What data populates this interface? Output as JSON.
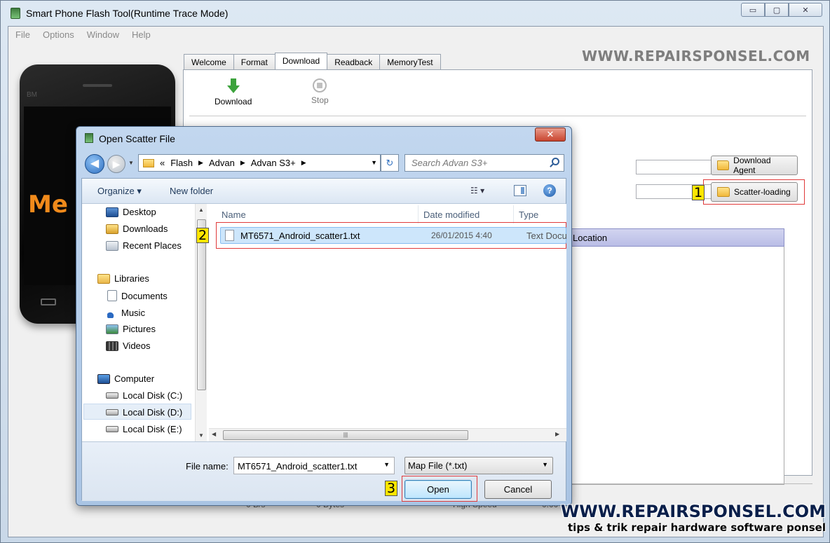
{
  "app": {
    "title": "Smart Phone Flash Tool(Runtime Trace Mode)",
    "window_controls": {
      "minimize": "▭",
      "maximize": "▢",
      "close": "✕"
    }
  },
  "menu": [
    "File",
    "Options",
    "Window",
    "Help"
  ],
  "phone": {
    "brand": "BM",
    "logo_text": "Me"
  },
  "watermarks": {
    "top": "WWW.REPAIRSPONSEL.COM",
    "bottom_main": "WWW.REPAIRSPONSEL.COM",
    "bottom_sub": "tips & trik repair hardware software ponsel"
  },
  "tabs": [
    "Welcome",
    "Format",
    "Download",
    "Readback",
    "MemoryTest"
  ],
  "active_tab": "Download",
  "toolbar": {
    "download_label": "Download",
    "stop_label": "Stop"
  },
  "side_buttons": {
    "download_agent": "Download Agent",
    "scatter_loading": "Scatter-loading"
  },
  "location_header": "Location",
  "status_bar": [
    "0 B/s",
    "0 Bytes",
    "High Speed",
    "0:00"
  ],
  "steps": {
    "one": "1",
    "two": "2",
    "three": "3"
  },
  "dialog": {
    "title": "Open Scatter File",
    "close": "✕",
    "breadcrumb": [
      "Flash",
      "Advan",
      "Advan S3+"
    ],
    "breadcrumb_prefix": "«",
    "search_placeholder": "Search Advan S3+",
    "commands": {
      "organize": "Organize ▾",
      "new_folder": "New folder",
      "views": "☷ ▾",
      "help": "?"
    },
    "nav_items": [
      {
        "label": "Desktop",
        "icon": "desktop-icon"
      },
      {
        "label": "Downloads",
        "icon": "downloads-icon"
      },
      {
        "label": "Recent Places",
        "icon": "recent-places-icon"
      },
      {
        "label": "Libraries",
        "icon": "libraries-icon"
      },
      {
        "label": "Documents",
        "icon": "documents-icon"
      },
      {
        "label": "Music",
        "icon": "music-icon"
      },
      {
        "label": "Pictures",
        "icon": "pictures-icon"
      },
      {
        "label": "Videos",
        "icon": "videos-icon"
      },
      {
        "label": "Computer",
        "icon": "computer-icon"
      },
      {
        "label": "Local Disk (C:)",
        "icon": "disk-icon"
      },
      {
        "label": "Local Disk (D:)",
        "icon": "disk-icon"
      },
      {
        "label": "Local Disk (E:)",
        "icon": "disk-icon"
      }
    ],
    "selected_nav": "Local Disk (D:)",
    "columns": [
      "Name",
      "Date modified",
      "Type"
    ],
    "files": [
      {
        "name": "MT6571_Android_scatter1.txt",
        "date": "26/01/2015 4:40",
        "type": "Text Document"
      }
    ],
    "file_name_label": "File name:",
    "file_name_value": "MT6571_Android_scatter1.txt",
    "filter": "Map File (*.txt)",
    "open_label": "Open",
    "cancel_label": "Cancel"
  }
}
